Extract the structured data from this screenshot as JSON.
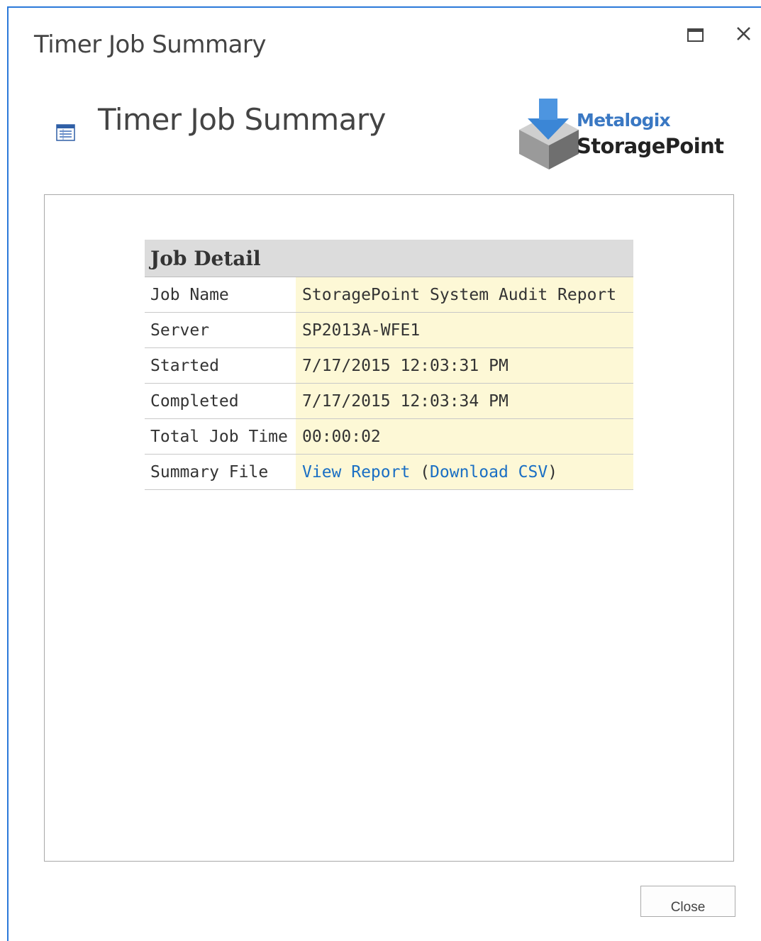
{
  "window": {
    "title": "Timer Job Summary"
  },
  "page": {
    "heading": "Timer Job Summary"
  },
  "brand": {
    "top": "Metalogix",
    "main": "StoragePoint"
  },
  "job_detail": {
    "header": "Job Detail",
    "rows": [
      {
        "label": "Job Name",
        "value": "StoragePoint System Audit Report"
      },
      {
        "label": "Server",
        "value": "SP2013A-WFE1"
      },
      {
        "label": "Started",
        "value": "7/17/2015 12:03:31 PM"
      },
      {
        "label": "Completed",
        "value": "7/17/2015 12:03:34 PM"
      },
      {
        "label": "Total Job Time",
        "value": "00:00:02"
      }
    ],
    "summary_file": {
      "label": "Summary File",
      "view_report": "View Report",
      "open_paren": "(",
      "download_csv": "Download CSV",
      "close_paren": ")"
    }
  },
  "footer": {
    "close_label": "Close"
  },
  "icons": {
    "maximize": "maximize-icon",
    "close": "close-icon",
    "page": "list-page-icon",
    "logo": "storagepoint-logo"
  },
  "colors": {
    "accent_border": "#2b79d9",
    "link": "#1a6fc4",
    "value_bg": "#fdf8d6",
    "header_bg": "#dcdcdc"
  }
}
